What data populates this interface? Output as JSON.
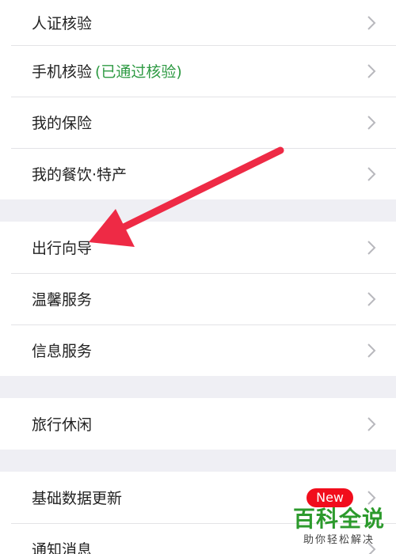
{
  "groups": [
    {
      "items": [
        {
          "label": "人证核验"
        },
        {
          "label": "手机核验",
          "status": "(已通过核验)"
        },
        {
          "label": "我的保险"
        },
        {
          "label": "我的餐饮·特产"
        }
      ]
    },
    {
      "items": [
        {
          "label": "出行向导"
        },
        {
          "label": "温馨服务"
        },
        {
          "label": "信息服务"
        }
      ]
    },
    {
      "items": [
        {
          "label": "旅行休闲"
        }
      ]
    },
    {
      "items": [
        {
          "label": "基础数据更新",
          "badge": "New"
        },
        {
          "label": "通知消息"
        }
      ]
    }
  ],
  "watermark": {
    "title": "百科全说",
    "subtitle": "助你轻松解决"
  },
  "colors": {
    "status_green": "#2e9a43",
    "badge_red": "#f10d1c",
    "arrow_red": "#ee2a45",
    "watermark_green": "#2c9a2c"
  }
}
